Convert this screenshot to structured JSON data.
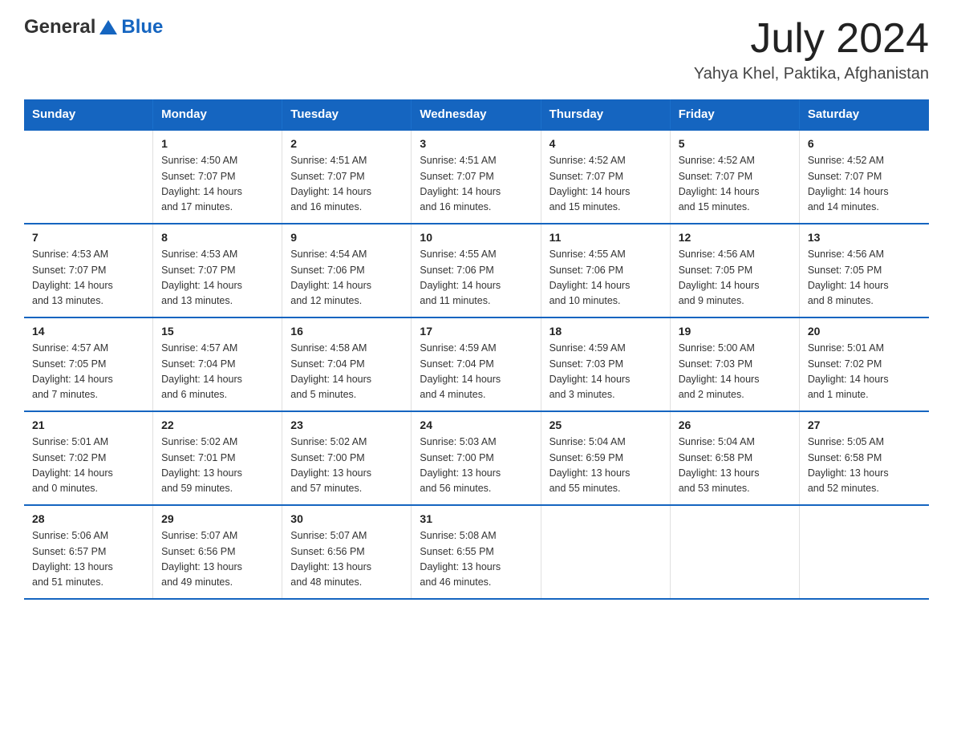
{
  "header": {
    "logo_text_general": "General",
    "logo_text_blue": "Blue",
    "month_year": "July 2024",
    "location": "Yahya Khel, Paktika, Afghanistan"
  },
  "calendar": {
    "days_of_week": [
      "Sunday",
      "Monday",
      "Tuesday",
      "Wednesday",
      "Thursday",
      "Friday",
      "Saturday"
    ],
    "rows": [
      [
        {
          "day": "",
          "info": []
        },
        {
          "day": "1",
          "info": [
            "Sunrise: 4:50 AM",
            "Sunset: 7:07 PM",
            "Daylight: 14 hours",
            "and 17 minutes."
          ]
        },
        {
          "day": "2",
          "info": [
            "Sunrise: 4:51 AM",
            "Sunset: 7:07 PM",
            "Daylight: 14 hours",
            "and 16 minutes."
          ]
        },
        {
          "day": "3",
          "info": [
            "Sunrise: 4:51 AM",
            "Sunset: 7:07 PM",
            "Daylight: 14 hours",
            "and 16 minutes."
          ]
        },
        {
          "day": "4",
          "info": [
            "Sunrise: 4:52 AM",
            "Sunset: 7:07 PM",
            "Daylight: 14 hours",
            "and 15 minutes."
          ]
        },
        {
          "day": "5",
          "info": [
            "Sunrise: 4:52 AM",
            "Sunset: 7:07 PM",
            "Daylight: 14 hours",
            "and 15 minutes."
          ]
        },
        {
          "day": "6",
          "info": [
            "Sunrise: 4:52 AM",
            "Sunset: 7:07 PM",
            "Daylight: 14 hours",
            "and 14 minutes."
          ]
        }
      ],
      [
        {
          "day": "7",
          "info": [
            "Sunrise: 4:53 AM",
            "Sunset: 7:07 PM",
            "Daylight: 14 hours",
            "and 13 minutes."
          ]
        },
        {
          "day": "8",
          "info": [
            "Sunrise: 4:53 AM",
            "Sunset: 7:07 PM",
            "Daylight: 14 hours",
            "and 13 minutes."
          ]
        },
        {
          "day": "9",
          "info": [
            "Sunrise: 4:54 AM",
            "Sunset: 7:06 PM",
            "Daylight: 14 hours",
            "and 12 minutes."
          ]
        },
        {
          "day": "10",
          "info": [
            "Sunrise: 4:55 AM",
            "Sunset: 7:06 PM",
            "Daylight: 14 hours",
            "and 11 minutes."
          ]
        },
        {
          "day": "11",
          "info": [
            "Sunrise: 4:55 AM",
            "Sunset: 7:06 PM",
            "Daylight: 14 hours",
            "and 10 minutes."
          ]
        },
        {
          "day": "12",
          "info": [
            "Sunrise: 4:56 AM",
            "Sunset: 7:05 PM",
            "Daylight: 14 hours",
            "and 9 minutes."
          ]
        },
        {
          "day": "13",
          "info": [
            "Sunrise: 4:56 AM",
            "Sunset: 7:05 PM",
            "Daylight: 14 hours",
            "and 8 minutes."
          ]
        }
      ],
      [
        {
          "day": "14",
          "info": [
            "Sunrise: 4:57 AM",
            "Sunset: 7:05 PM",
            "Daylight: 14 hours",
            "and 7 minutes."
          ]
        },
        {
          "day": "15",
          "info": [
            "Sunrise: 4:57 AM",
            "Sunset: 7:04 PM",
            "Daylight: 14 hours",
            "and 6 minutes."
          ]
        },
        {
          "day": "16",
          "info": [
            "Sunrise: 4:58 AM",
            "Sunset: 7:04 PM",
            "Daylight: 14 hours",
            "and 5 minutes."
          ]
        },
        {
          "day": "17",
          "info": [
            "Sunrise: 4:59 AM",
            "Sunset: 7:04 PM",
            "Daylight: 14 hours",
            "and 4 minutes."
          ]
        },
        {
          "day": "18",
          "info": [
            "Sunrise: 4:59 AM",
            "Sunset: 7:03 PM",
            "Daylight: 14 hours",
            "and 3 minutes."
          ]
        },
        {
          "day": "19",
          "info": [
            "Sunrise: 5:00 AM",
            "Sunset: 7:03 PM",
            "Daylight: 14 hours",
            "and 2 minutes."
          ]
        },
        {
          "day": "20",
          "info": [
            "Sunrise: 5:01 AM",
            "Sunset: 7:02 PM",
            "Daylight: 14 hours",
            "and 1 minute."
          ]
        }
      ],
      [
        {
          "day": "21",
          "info": [
            "Sunrise: 5:01 AM",
            "Sunset: 7:02 PM",
            "Daylight: 14 hours",
            "and 0 minutes."
          ]
        },
        {
          "day": "22",
          "info": [
            "Sunrise: 5:02 AM",
            "Sunset: 7:01 PM",
            "Daylight: 13 hours",
            "and 59 minutes."
          ]
        },
        {
          "day": "23",
          "info": [
            "Sunrise: 5:02 AM",
            "Sunset: 7:00 PM",
            "Daylight: 13 hours",
            "and 57 minutes."
          ]
        },
        {
          "day": "24",
          "info": [
            "Sunrise: 5:03 AM",
            "Sunset: 7:00 PM",
            "Daylight: 13 hours",
            "and 56 minutes."
          ]
        },
        {
          "day": "25",
          "info": [
            "Sunrise: 5:04 AM",
            "Sunset: 6:59 PM",
            "Daylight: 13 hours",
            "and 55 minutes."
          ]
        },
        {
          "day": "26",
          "info": [
            "Sunrise: 5:04 AM",
            "Sunset: 6:58 PM",
            "Daylight: 13 hours",
            "and 53 minutes."
          ]
        },
        {
          "day": "27",
          "info": [
            "Sunrise: 5:05 AM",
            "Sunset: 6:58 PM",
            "Daylight: 13 hours",
            "and 52 minutes."
          ]
        }
      ],
      [
        {
          "day": "28",
          "info": [
            "Sunrise: 5:06 AM",
            "Sunset: 6:57 PM",
            "Daylight: 13 hours",
            "and 51 minutes."
          ]
        },
        {
          "day": "29",
          "info": [
            "Sunrise: 5:07 AM",
            "Sunset: 6:56 PM",
            "Daylight: 13 hours",
            "and 49 minutes."
          ]
        },
        {
          "day": "30",
          "info": [
            "Sunrise: 5:07 AM",
            "Sunset: 6:56 PM",
            "Daylight: 13 hours",
            "and 48 minutes."
          ]
        },
        {
          "day": "31",
          "info": [
            "Sunrise: 5:08 AM",
            "Sunset: 6:55 PM",
            "Daylight: 13 hours",
            "and 46 minutes."
          ]
        },
        {
          "day": "",
          "info": []
        },
        {
          "day": "",
          "info": []
        },
        {
          "day": "",
          "info": []
        }
      ]
    ]
  }
}
